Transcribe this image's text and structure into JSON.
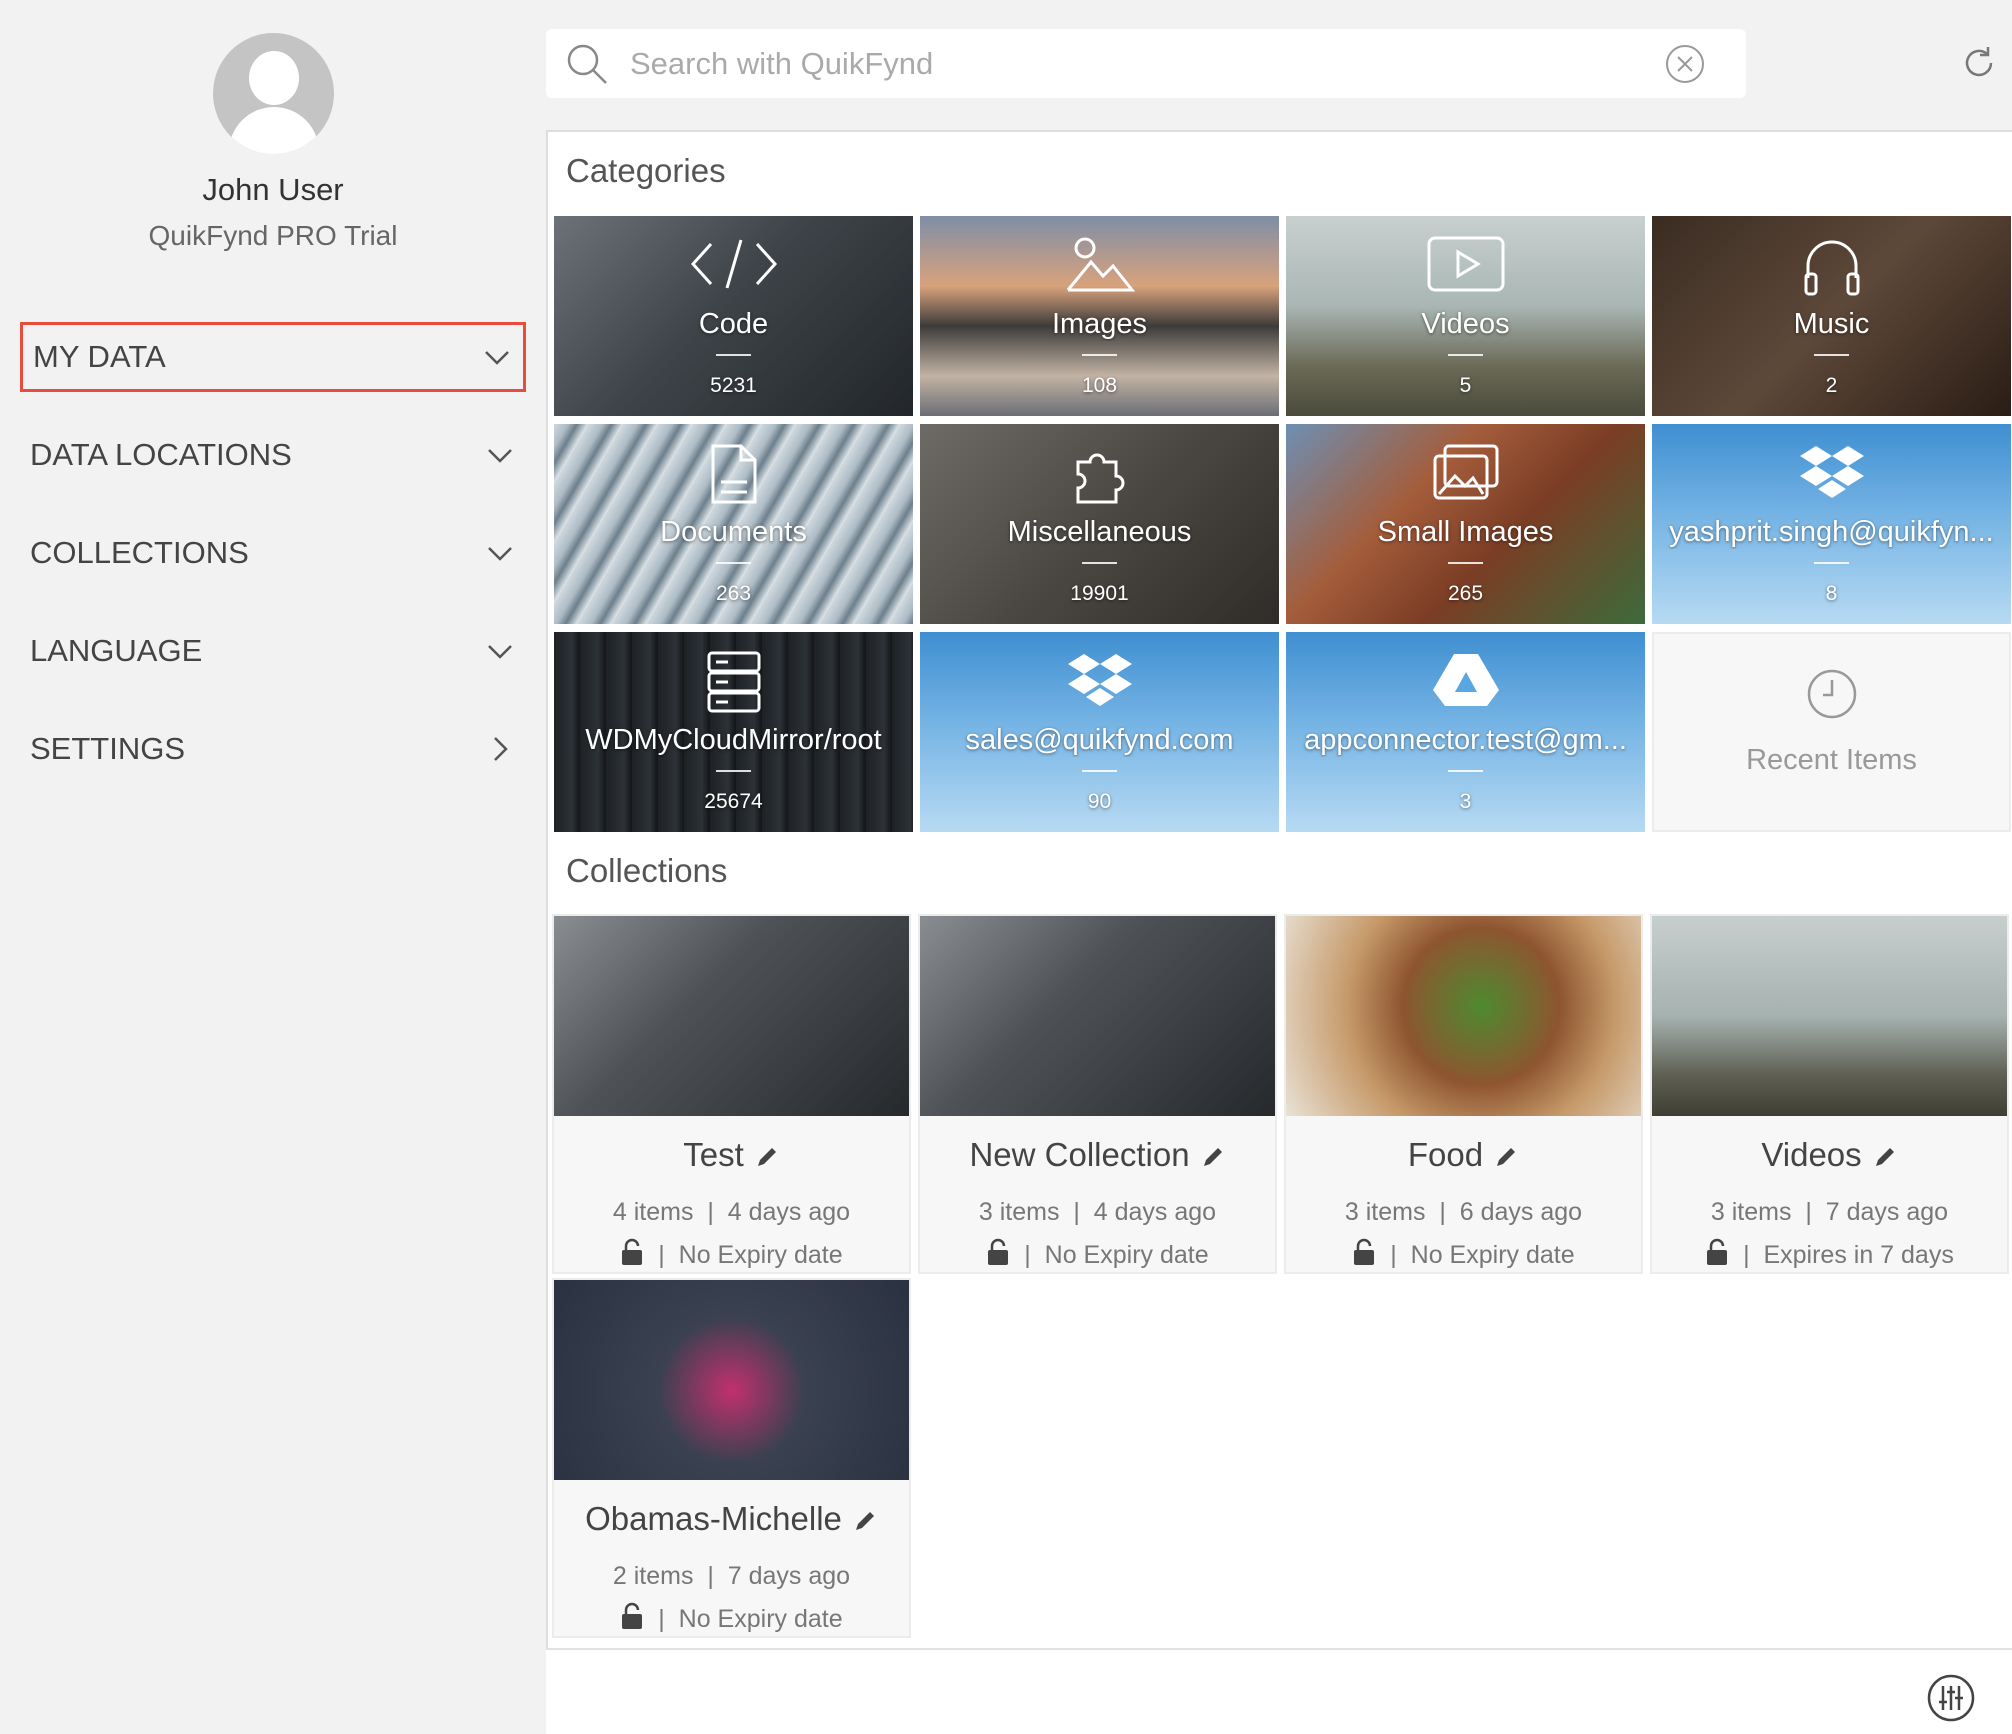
{
  "user": {
    "name": "John User",
    "plan": "QuikFynd PRO Trial"
  },
  "nav": [
    {
      "label": "MY DATA",
      "chevron": "down"
    },
    {
      "label": "DATA LOCATIONS",
      "chevron": "down"
    },
    {
      "label": "COLLECTIONS",
      "chevron": "down"
    },
    {
      "label": "LANGUAGE",
      "chevron": "down"
    },
    {
      "label": "SETTINGS",
      "chevron": "right"
    }
  ],
  "search": {
    "placeholder": "Search with QuikFynd"
  },
  "categories_title": "Categories",
  "categories": [
    {
      "label": "Code",
      "count": "5231",
      "icon": "code-icon"
    },
    {
      "label": "Images",
      "count": "108",
      "icon": "image-icon"
    },
    {
      "label": "Videos",
      "count": "5",
      "icon": "video-icon"
    },
    {
      "label": "Music",
      "count": "2",
      "icon": "headphones-icon"
    },
    {
      "label": "Documents",
      "count": "263",
      "icon": "document-icon"
    },
    {
      "label": "Miscellaneous",
      "count": "19901",
      "icon": "puzzle-icon"
    },
    {
      "label": "Small Images",
      "count": "265",
      "icon": "gallery-icon"
    },
    {
      "label": "yashprit.singh@quikfyn...",
      "count": "8",
      "icon": "dropbox-icon"
    },
    {
      "label": "WDMyCloudMirror/root",
      "count": "25674",
      "icon": "server-icon"
    },
    {
      "label": "sales@quikfynd.com",
      "count": "90",
      "icon": "dropbox-icon"
    },
    {
      "label": "appconnector.test@gm...",
      "count": "3",
      "icon": "google-drive-icon"
    },
    {
      "label": "Recent Items",
      "icon": "clock-icon"
    }
  ],
  "collections_title": "Collections",
  "collections": [
    {
      "name": "Test",
      "items": "4 items",
      "age": "4 days ago",
      "expiry": "No Expiry date"
    },
    {
      "name": "New Collection",
      "items": "3 items",
      "age": "4 days ago",
      "expiry": "No Expiry date"
    },
    {
      "name": "Food",
      "items": "3 items",
      "age": "6 days ago",
      "expiry": "No Expiry date"
    },
    {
      "name": "Videos",
      "items": "3 items",
      "age": "7 days ago",
      "expiry": "Expires in 7 days"
    },
    {
      "name": "Obamas-Michelle",
      "items": "2 items",
      "age": "7 days ago",
      "expiry": "No Expiry date"
    }
  ],
  "colors": {
    "highlight": "#e74c3c",
    "sidebar_bg": "#f2f2f2",
    "sky_tile": "#5aa6e0"
  }
}
